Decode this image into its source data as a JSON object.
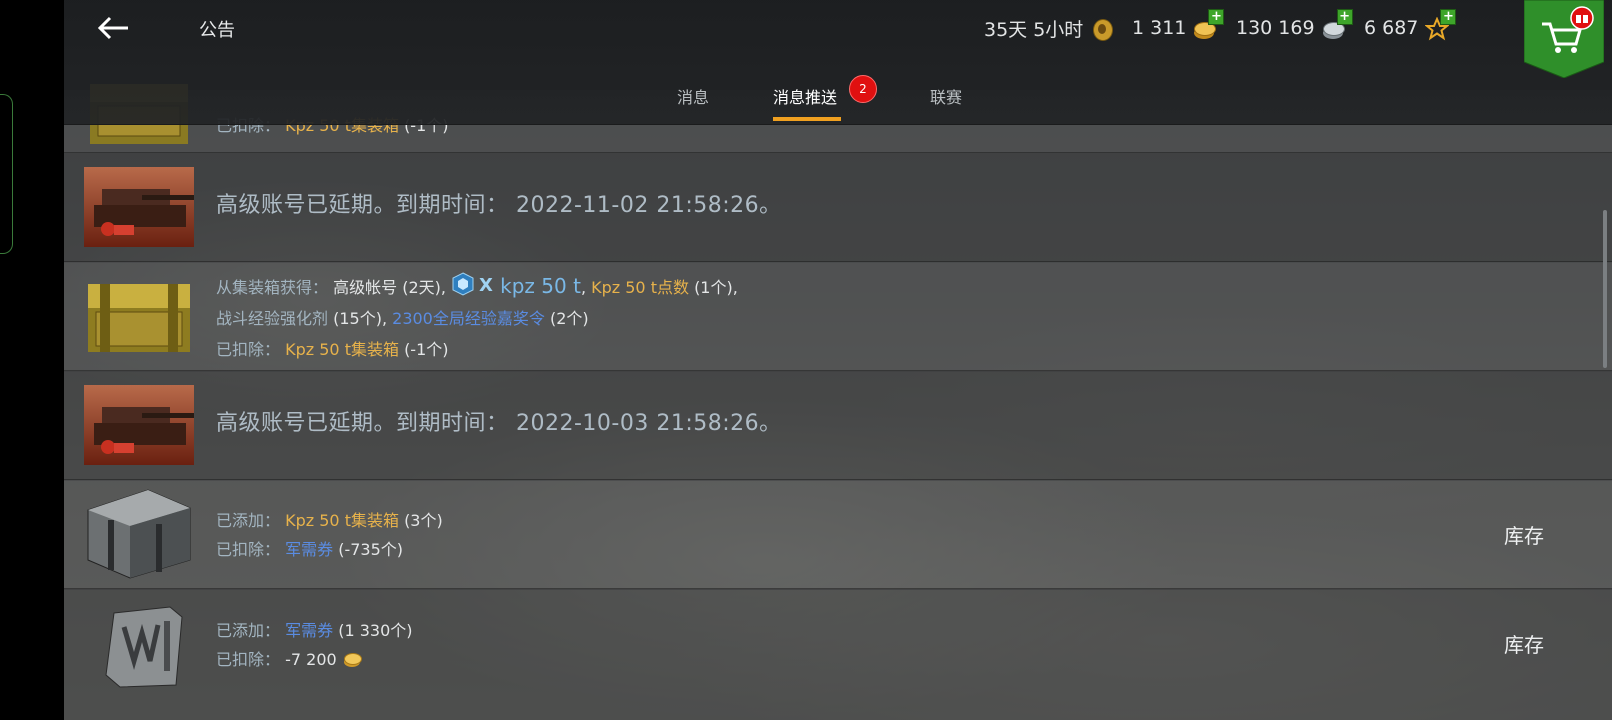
{
  "header": {
    "title": "公告",
    "premium_time": "35天 5小时",
    "gold": "1 311",
    "credits": "130 169",
    "free_xp": "6 687"
  },
  "tabs": [
    {
      "label": "消息"
    },
    {
      "label": "消息推送",
      "badge": "2"
    },
    {
      "label": "联赛"
    }
  ],
  "messages": {
    "m0": {
      "deducted_label": "已扣除：",
      "item": "Kpz 50 t集装箱",
      "qty": "(-1个)"
    },
    "m1": {
      "text": "高级账号已延期。到期时间： 2022-11-02 21:58:26。"
    },
    "m2": {
      "from_label": "从集装箱获得：",
      "r1": "高级帐号",
      "r1q": "(2天)",
      "tank": "kpz 50 t",
      "r3": "Kpz 50 t点数",
      "r3q": "(1个)",
      "r4": "战斗经验强化剂",
      "r4q": "(15个)",
      "r5": "2300全局经验嘉奖令",
      "r5q": "(2个)",
      "deducted_label": "已扣除：",
      "ded": "Kpz 50 t集装箱",
      "dedq": "(-1个)"
    },
    "m3": {
      "text": "高级账号已延期。到期时间： 2022-10-03 21:58:26。"
    },
    "m4": {
      "added_label": "已添加：",
      "add": "Kpz 50 t集装箱",
      "addq": "(3个)",
      "deducted_label": "已扣除：",
      "ded": "军需券",
      "dedq": "(-735个)",
      "button": "库存"
    },
    "m5": {
      "added_label": "已添加：",
      "add": "军需券",
      "addq": "(1 330个)",
      "deducted_label": "已扣除：",
      "ded": "-7 200",
      "button": "库存"
    }
  },
  "colors": {
    "accent": "#f0a020",
    "item_gold": "#e7b24b",
    "item_blue": "#5a8ce2",
    "badge": "#e01010",
    "shop": "#2f8f2a"
  }
}
